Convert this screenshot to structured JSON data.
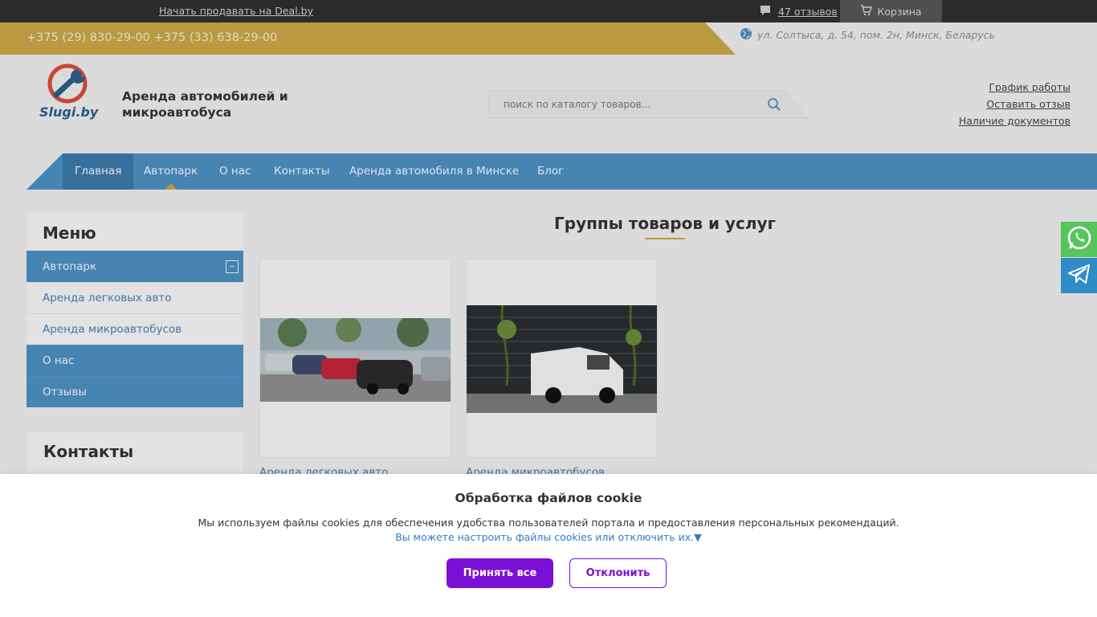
{
  "topbar": {
    "sell_link": "Начать продавать на Deal.by",
    "reviews_link": "47 отзывов",
    "cart_label": "Корзина"
  },
  "contacts_band": {
    "phones": "+375 (29) 830-29-00 +375 (33) 638-29-00",
    "address": "ул. Солтыса, д. 54, пом. 2н, Минск, Беларусь"
  },
  "header": {
    "logo_text": "Slugi.by",
    "site_title": "Аренда автомобилей и микроавтобуса",
    "search_placeholder": "поиск по каталогу товаров...",
    "links": [
      "График работы",
      "Оставить отзыв",
      "Наличие документов"
    ]
  },
  "nav": {
    "items": [
      "Главная",
      "Автопарк",
      "О нас",
      "Контакты",
      "Аренда автомобиля в Минске",
      "Блог"
    ]
  },
  "sidebar": {
    "menu_title": "Меню",
    "items": [
      {
        "label": "Автопарк"
      },
      {
        "label": "Аренда легковых авто"
      },
      {
        "label": "Аренда микроавтобусов"
      },
      {
        "label": "О нас"
      },
      {
        "label": "Отзывы"
      }
    ],
    "contacts_title": "Контакты"
  },
  "main": {
    "section_title": "Группы товаров и услуг",
    "cards": [
      {
        "caption": "Аренда легковых авто"
      },
      {
        "caption": "Аренда микроавтобусов"
      }
    ]
  },
  "cookie": {
    "title": "Обработка файлов cookie",
    "text": "Мы используем файлы cookies для обеспечения удобства пользователей портала и предоставления персональных рекомендаций.",
    "settings_link": "Вы можете настроить файлы cookies или отключить их.▼",
    "accept_label": "Принять все",
    "decline_label": "Отклонить"
  },
  "colors": {
    "nav_blue": "#4c8fbf",
    "gold": "#c9a546",
    "accent_purple": "#7a10d6",
    "whatsapp_green": "#55c65a",
    "telegram_blue": "#2f8cc7"
  },
  "icons": [
    "chat-icon",
    "cart-icon",
    "globe-icon",
    "search-icon",
    "minus-icon",
    "whatsapp-icon",
    "telegram-icon"
  ]
}
